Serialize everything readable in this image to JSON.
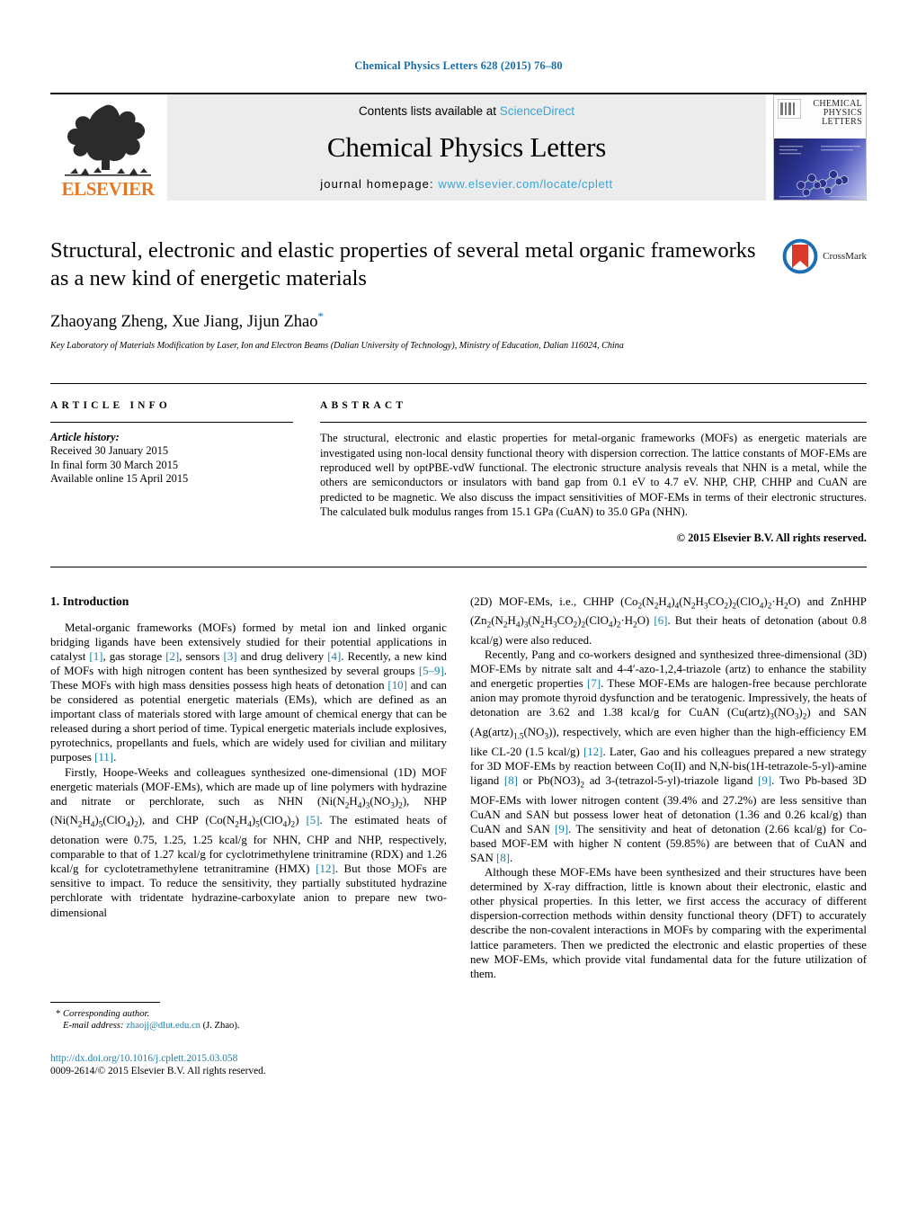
{
  "running_head": "Chemical Physics Letters 628 (2015) 76–80",
  "masthead": {
    "contents_prefix": "Contents lists available at ",
    "sciencedirect": "ScienceDirect",
    "journal_name": "Chemical Physics Letters",
    "homepage_label": "journal homepage:",
    "homepage_url": "www.elsevier.com/locate/cplett",
    "publisher": "ELSEVIER",
    "cover_title_line1": "CHEMICAL",
    "cover_title_line2": "PHYSICS",
    "cover_title_line3": "LETTERS",
    "logo_icon": "elsevier-tree-logo",
    "cover_icon": "journal-cover-thumbnail"
  },
  "title_block": {
    "title": "Structural, electronic and elastic properties of several metal organic frameworks as a new kind of energetic materials",
    "authors": "Zhaoyang Zheng, Xue Jiang, Jijun Zhao",
    "corresponding_marker": "*",
    "affiliation": "Key Laboratory of Materials Modification by Laser, Ion and Electron Beams (Dalian University of Technology), Ministry of Education, Dalian 116024, China",
    "crossmark_label": "CrossMark",
    "crossmark_icon": "crossmark-logo"
  },
  "article_info": {
    "heading": "ARTICLE INFO",
    "history_label": "Article history:",
    "history": [
      "Received 30 January 2015",
      "In final form 30 March 2015",
      "Available online 15 April 2015"
    ]
  },
  "abstract": {
    "heading": "ABSTRACT",
    "text": "The structural, electronic and elastic properties for metal-organic frameworks (MOFs) as energetic materials are investigated using non-local density functional theory with dispersion correction. The lattice constants of MOF-EMs are reproduced well by optPBE-vdW functional. The electronic structure analysis reveals that NHN is a metal, while the others are semiconductors or insulators with band gap from 0.1 eV to 4.7 eV. NHP, CHP, CHHP and CuAN are predicted to be magnetic. We also discuss the impact sensitivities of MOF-EMs in terms of their electronic structures. The calculated bulk modulus ranges from 15.1 GPa (CuAN) to 35.0 GPa (NHN).",
    "copyright": "© 2015 Elsevier B.V. All rights reserved."
  },
  "body": {
    "section_heading": "1. Introduction",
    "left_paragraphs": [
      "Metal-organic frameworks (MOFs) formed by metal ion and linked organic bridging ligands have been extensively studied for their potential applications in catalyst [1], gas storage [2], sensors [3] and drug delivery [4]. Recently, a new kind of MOFs with high nitrogen content has been synthesized by several groups [5–9]. These MOFs with high mass densities possess high heats of detonation [10] and can be considered as potential energetic materials (EMs), which are defined as an important class of materials stored with large amount of chemical energy that can be released during a short period of time. Typical energetic materials include explosives, pyrotechnics, propellants and fuels, which are widely used for civilian and military purposes [11].",
      "Firstly, Hoope-Weeks and colleagues synthesized one-dimensional (1D) MOF energetic materials (MOF-EMs), which are made up of line polymers with hydrazine and nitrate or perchlorate, such as NHN (Ni(N2H4)3(NO3)2), NHP (Ni(N2H4)5(ClO4)2), and CHP (Co(N2H4)5(ClO4)2) [5]. The estimated heats of detonation were 0.75, 1.25, 1.25 kcal/g for NHN, CHP and NHP, respectively, comparable to that of 1.27 kcal/g for cyclotrimethylene trinitramine (RDX) and 1.26 kcal/g for cyclotetramethylene tetranitramine (HMX) [12]. But those MOFs are sensitive to impact. To reduce the sensitivity, they partially substituted hydrazine perchlorate with tridentate hydrazine-carboxylate anion to prepare new two-dimensional"
    ],
    "right_paragraphs": [
      "(2D) MOF-EMs, i.e., CHHP (Co2(N2H4)4(N2H3CO2)2(ClO4)2·H2O) and ZnHHP (Zn2(N2H4)3(N2H3CO2)2(ClO4)2·H2O) [6]. But their heats of detonation (about 0.8 kcal/g) were also reduced.",
      "Recently, Pang and co-workers designed and synthesized three-dimensional (3D) MOF-EMs by nitrate salt and 4-4′-azo-1,2,4-triazole (artz) to enhance the stability and energetic properties [7]. These MOF-EMs are halogen-free because perchlorate anion may promote thyroid dysfunction and be teratogenic. Impressively, the heats of detonation are 3.62 and 1.38 kcal/g for CuAN (Cu(artz)3(NO3)2) and SAN (Ag(artz)1.5(NO3)), respectively, which are even higher than the high-efficiency EM like CL-20 (1.5 kcal/g) [12]. Later, Gao and his colleagues prepared a new strategy for 3D MOF-EMs by reaction between Co(II) and N,N-bis(1H-tetrazole-5-yl)-amine ligand [8] or Pb(NO3)2 ad 3-(tetrazol-5-yl)-triazole ligand [9]. Two Pb-based 3D MOF-EMs with lower nitrogen content (39.4% and 27.2%) are less sensitive than CuAN and SAN but possess lower heat of detonation (1.36 and 0.26 kcal/g) than CuAN and SAN [9]. The sensitivity and heat of detonation (2.66 kcal/g) for Co-based MOF-EM with higher N content (59.85%) are between that of CuAN and SAN [8].",
      "Although these MOF-EMs have been synthesized and their structures have been determined by X-ray diffraction, little is known about their electronic, elastic and other physical properties. In this letter, we first access the accuracy of different dispersion-correction methods within density functional theory (DFT) to accurately describe the non-covalent interactions in MOFs by comparing with the experimental lattice parameters. Then we predicted the electronic and elastic properties of these new MOF-EMs, which provide vital fundamental data for the future utilization of them."
    ]
  },
  "footnotes": {
    "corresponding_marker": "*",
    "corresponding_label": "Corresponding author.",
    "email_label": "E-mail address:",
    "email": "zhaojj@dlut.edu.cn",
    "email_suffix": "(J. Zhao).",
    "doi": "http://dx.doi.org/10.1016/j.cplett.2015.03.058",
    "issn_line": "0009-2614/© 2015 Elsevier B.V. All rights reserved."
  },
  "colors": {
    "link": "#1a7fa8",
    "running_head": "#1a6ea8",
    "elsevier_orange": "#e87722",
    "sciencedirect_blue": "#3aa5d4"
  }
}
